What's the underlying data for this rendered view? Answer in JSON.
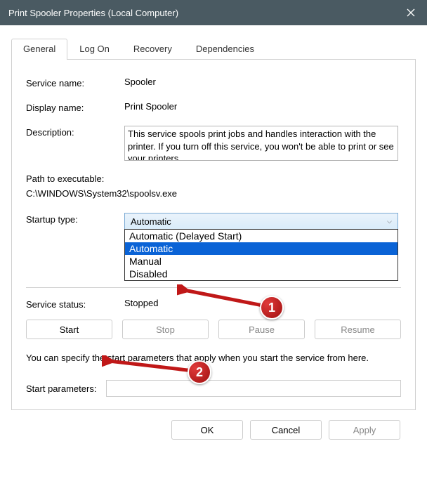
{
  "title": "Print Spooler Properties (Local Computer)",
  "tabs": {
    "general": "General",
    "logon": "Log On",
    "recovery": "Recovery",
    "dependencies": "Dependencies"
  },
  "labels": {
    "service_name": "Service name:",
    "display_name": "Display name:",
    "description": "Description:",
    "path": "Path to executable:",
    "startup_type": "Startup type:",
    "service_status": "Service status:",
    "help": "You can specify the start parameters that apply when you start the service from here.",
    "start_params": "Start parameters:"
  },
  "values": {
    "service_name": "Spooler",
    "display_name": "Print Spooler",
    "description": "This service spools print jobs and handles interaction with the printer.  If you turn off this service, you won't be able to print or see your printers.",
    "path": "C:\\WINDOWS\\System32\\spoolsv.exe",
    "startup_selected": "Automatic",
    "status": "Stopped",
    "start_params": ""
  },
  "dropdown": {
    "opt1": "Automatic (Delayed Start)",
    "opt2": "Automatic",
    "opt3": "Manual",
    "opt4": "Disabled"
  },
  "buttons": {
    "start": "Start",
    "stop": "Stop",
    "pause": "Pause",
    "resume": "Resume",
    "ok": "OK",
    "cancel": "Cancel",
    "apply": "Apply"
  },
  "annotations": {
    "a1": "1",
    "a2": "2"
  }
}
